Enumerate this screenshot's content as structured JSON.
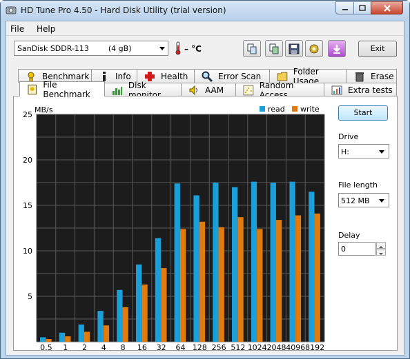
{
  "window": {
    "title": "HD Tune Pro 4.50 - Hard Disk Utility (trial version)"
  },
  "menu": {
    "file": "File",
    "help": "Help"
  },
  "toolbar": {
    "drive_value": "SanDisk SDDR-113        (4 gB)",
    "temperature": "– °C",
    "exit_label": "Exit",
    "icons": [
      "copy-info-icon",
      "copy-screenshot-icon",
      "save-icon",
      "options-icon",
      "download-arrow-icon"
    ]
  },
  "tabs_top": [
    {
      "label": "Benchmark",
      "icon": "benchmark-icon"
    },
    {
      "label": "Info",
      "icon": "info-icon"
    },
    {
      "label": "Health",
      "icon": "health-icon"
    },
    {
      "label": "Error Scan",
      "icon": "error-scan-icon"
    },
    {
      "label": "Folder Usage",
      "icon": "folder-icon"
    },
    {
      "label": "Erase",
      "icon": "erase-icon"
    }
  ],
  "tabs_bottom": [
    {
      "label": "File Benchmark",
      "icon": "file-benchmark-icon",
      "active": true
    },
    {
      "label": "Disk monitor",
      "icon": "disk-monitor-icon"
    },
    {
      "label": "AAM",
      "icon": "speaker-icon"
    },
    {
      "label": "Random Access",
      "icon": "random-access-icon"
    },
    {
      "label": "Extra tests",
      "icon": "extra-tests-icon"
    }
  ],
  "sidebar": {
    "start_label": "Start",
    "drive_label": "Drive",
    "drive_value": "H:",
    "file_length_label": "File length",
    "file_length_value": "512 MB",
    "delay_label": "Delay",
    "delay_value": "0"
  },
  "chart_data": {
    "type": "bar",
    "ylabel": "MB/s",
    "ylim": [
      0,
      25
    ],
    "yticks": [
      5,
      10,
      15,
      20,
      25
    ],
    "categories": [
      "0.5",
      "1",
      "2",
      "4",
      "8",
      "16",
      "32",
      "64",
      "128",
      "256",
      "512",
      "1024",
      "2048",
      "4096",
      "8192"
    ],
    "series": [
      {
        "name": "read",
        "color": "#1a9fd8",
        "values": [
          0.5,
          1.0,
          1.9,
          3.4,
          5.7,
          8.5,
          11.4,
          17.4,
          16.1,
          17.5,
          17.0,
          17.6,
          17.5,
          17.6,
          16.5
        ]
      },
      {
        "name": "write",
        "color": "#e07b10",
        "values": [
          0.3,
          0.6,
          1.1,
          1.8,
          3.8,
          6.3,
          8.1,
          12.4,
          13.2,
          12.6,
          13.7,
          12.4,
          13.4,
          13.9,
          14.1
        ]
      }
    ],
    "legend_placement": "top-right",
    "grid": true
  }
}
